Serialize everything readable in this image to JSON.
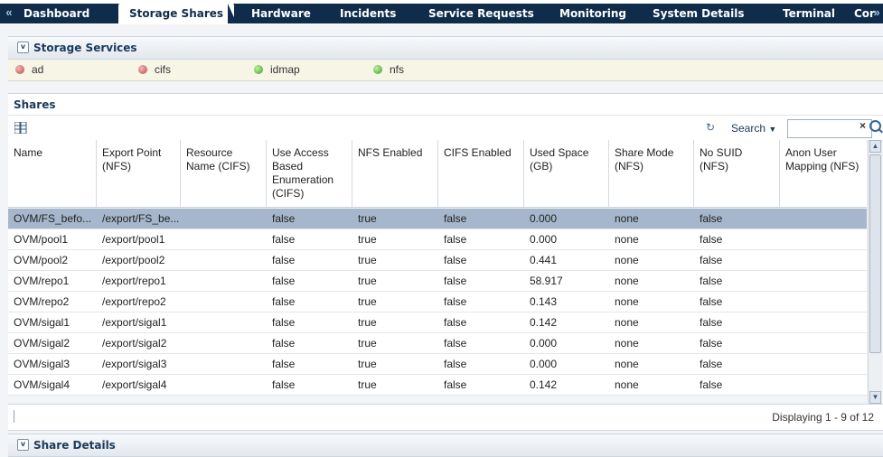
{
  "tabs": {
    "items": [
      {
        "label": "Dashboard",
        "active": false
      },
      {
        "label": "Storage Shares",
        "active": true
      },
      {
        "label": "Hardware",
        "active": false
      },
      {
        "label": "Incidents",
        "active": false
      },
      {
        "label": "Service Requests",
        "active": false
      },
      {
        "label": "Monitoring",
        "active": false
      },
      {
        "label": "System Details",
        "active": false
      },
      {
        "label": "Terminal",
        "active": false
      },
      {
        "label": "Cor",
        "active": false
      }
    ],
    "left_arrow": "«",
    "right_arrow": "»"
  },
  "storage_services": {
    "title": "Storage Services",
    "items": [
      {
        "name": "ad",
        "status": "error"
      },
      {
        "name": "cifs",
        "status": "error"
      },
      {
        "name": "idmap",
        "status": "ok"
      },
      {
        "name": "nfs",
        "status": "ok"
      }
    ]
  },
  "shares": {
    "title": "Shares",
    "search_label": "Search",
    "search_value": "",
    "clear_glyph": "×",
    "columns": [
      "Name",
      "Export Point (NFS)",
      "Resource Name (CIFS)",
      "Use Access Based Enumeration (CIFS)",
      "NFS Enabled",
      "CIFS Enabled",
      "Used Space (GB)",
      "Share Mode (NFS)",
      "No SUID (NFS)",
      "Anon User Mapping (NFS)"
    ],
    "rows": [
      [
        "OVM/FS_befo...",
        "/export/FS_be...",
        "",
        "false",
        "true",
        "false",
        "0.000",
        "none",
        "false",
        ""
      ],
      [
        "OVM/pool1",
        "/export/pool1",
        "",
        "false",
        "true",
        "false",
        "0.000",
        "none",
        "false",
        ""
      ],
      [
        "OVM/pool2",
        "/export/pool2",
        "",
        "false",
        "true",
        "false",
        "0.441",
        "none",
        "false",
        ""
      ],
      [
        "OVM/repo1",
        "/export/repo1",
        "",
        "false",
        "true",
        "false",
        "58.917",
        "none",
        "false",
        ""
      ],
      [
        "OVM/repo2",
        "/export/repo2",
        "",
        "false",
        "true",
        "false",
        "0.143",
        "none",
        "false",
        ""
      ],
      [
        "OVM/sigal1",
        "/export/sigal1",
        "",
        "false",
        "true",
        "false",
        "0.142",
        "none",
        "false",
        ""
      ],
      [
        "OVM/sigal2",
        "/export/sigal2",
        "",
        "false",
        "true",
        "false",
        "0.000",
        "none",
        "false",
        ""
      ],
      [
        "OVM/sigal3",
        "/export/sigal3",
        "",
        "false",
        "true",
        "false",
        "0.000",
        "none",
        "false",
        ""
      ],
      [
        "OVM/sigal4",
        "/export/sigal4",
        "",
        "false",
        "true",
        "false",
        "0.142",
        "none",
        "false",
        ""
      ]
    ],
    "selected_row": 0,
    "footer_text": "Displaying 1 - 9 of 12"
  },
  "share_details": {
    "title": "Share Details"
  },
  "colors": {
    "tab_bar": "#0f2c4a",
    "selected_row": "#a6b6cc",
    "services_bg": "#f6f5e6"
  }
}
